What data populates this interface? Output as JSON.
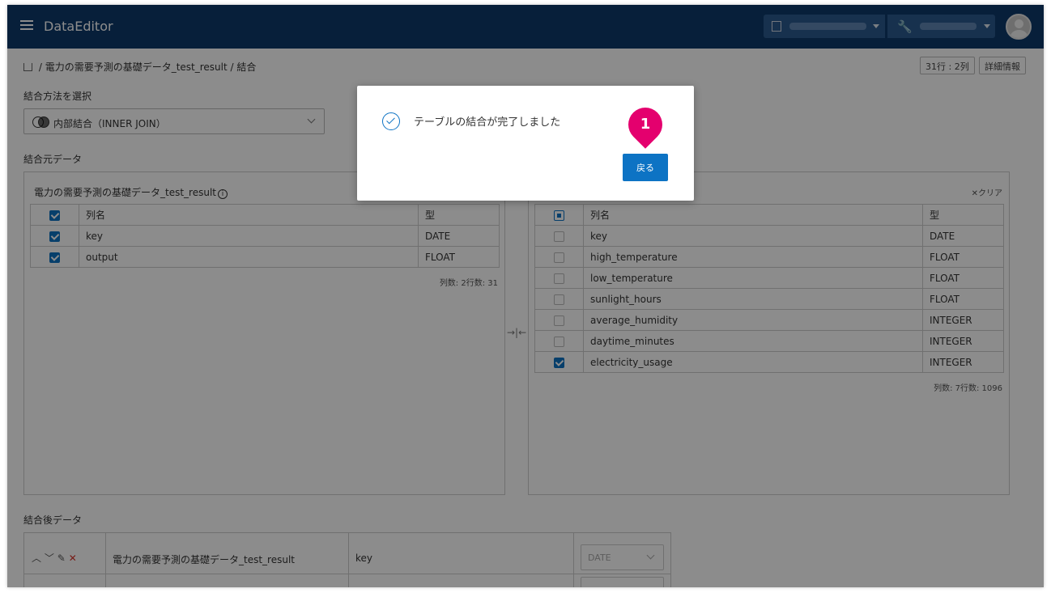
{
  "app": {
    "title": "DataEditor"
  },
  "header": {
    "org_icon": "building-icon",
    "tool_icon": "wrench-icon"
  },
  "breadcrumb": {
    "home_icon": "home-icon",
    "separator": "/",
    "dataset": "電力の需要予測の基礎データ_test_result",
    "current": "結合"
  },
  "meta": {
    "size": "31行 : 2列",
    "details": "詳細情報"
  },
  "join": {
    "section_label": "結合方法を選択",
    "method": "内部結合（INNER JOIN）"
  },
  "source": {
    "section_label": "結合元データ",
    "left": {
      "title": "電力の需要予測の基礎データ_test_result",
      "headers": [
        "列名",
        "型"
      ],
      "rows": [
        {
          "checked": true,
          "name": "key",
          "type": "DATE"
        },
        {
          "checked": true,
          "name": "output",
          "type": "FLOAT"
        }
      ],
      "stats": "列数: 2行数: 31"
    },
    "right": {
      "clear_label": "✕クリア",
      "headers": [
        "列名",
        "型"
      ],
      "rows": [
        {
          "checked": false,
          "name": "key",
          "type": "DATE"
        },
        {
          "checked": false,
          "name": "high_temperature",
          "type": "FLOAT"
        },
        {
          "checked": false,
          "name": "low_temperature",
          "type": "FLOAT"
        },
        {
          "checked": false,
          "name": "sunlight_hours",
          "type": "FLOAT"
        },
        {
          "checked": false,
          "name": "average_humidity",
          "type": "INTEGER"
        },
        {
          "checked": false,
          "name": "daytime_minutes",
          "type": "INTEGER"
        },
        {
          "checked": true,
          "name": "electricity_usage",
          "type": "INTEGER"
        }
      ],
      "stats": "列数: 7行数: 1096"
    }
  },
  "result": {
    "section_label": "結合後データ",
    "rows": [
      {
        "source": "電力の需要予測の基礎データ_test_result",
        "column": "key",
        "type": "DATE"
      }
    ]
  },
  "modal": {
    "message": "テーブルの結合が完了しました",
    "back_label": "戻る",
    "marker_number": "1",
    "marker_color": "#e4006e",
    "accent_color": "#0d73c4"
  }
}
